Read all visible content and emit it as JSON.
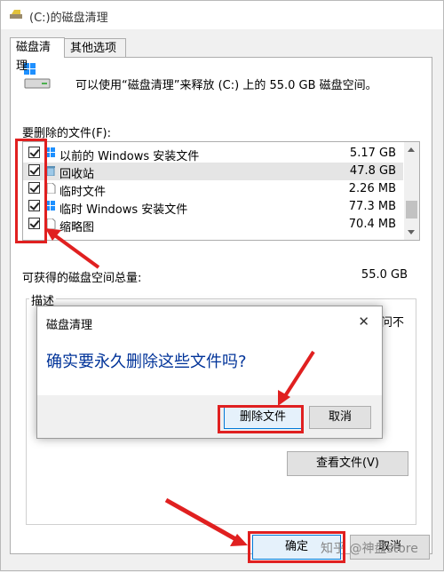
{
  "window": {
    "title": "(C:)的磁盘清理"
  },
  "tabs": [
    {
      "label": "磁盘清理"
    },
    {
      "label": "其他选项"
    }
  ],
  "info_text": "可以使用“磁盘清理”来释放 (C:) 上的 55.0 GB 磁盘空间。",
  "files_label": "要删除的文件(F):",
  "files": [
    {
      "name": "以前的 Windows 安装文件",
      "size": "5.17 GB",
      "checked": true,
      "icon": "windows-icon"
    },
    {
      "name": "回收站",
      "size": "47.8 GB",
      "checked": true,
      "icon": "recycle-bin-icon"
    },
    {
      "name": "临时文件",
      "size": "2.26 MB",
      "checked": true,
      "icon": "file-icon"
    },
    {
      "name": "临时 Windows 安装文件",
      "size": "77.3 MB",
      "checked": true,
      "icon": "windows-icon"
    },
    {
      "name": "缩略图",
      "size": "70.4 MB",
      "checked": true,
      "icon": "file-icon"
    }
  ],
  "total": {
    "label": "可获得的磁盘空间总量:",
    "value": "55.0 GB"
  },
  "description": {
    "label": "描述",
    "fragment_1": "问",
    "fragment_2": "不"
  },
  "buttons": {
    "view_files": "查看文件(V)",
    "ok": "确定",
    "cancel": "取消"
  },
  "dialog": {
    "title": "磁盘清理",
    "close": "✕",
    "message": "确实要永久删除这些文件吗?",
    "delete": "删除文件",
    "cancel": "取消"
  },
  "watermark": "知乎 @神盘store",
  "colors": {
    "annotation": "#e02020",
    "accent": "#0078d7",
    "message": "#003399"
  }
}
